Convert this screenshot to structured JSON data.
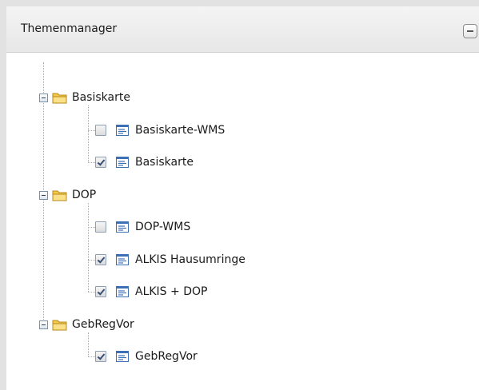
{
  "panel": {
    "title": "Themenmanager"
  },
  "tree": {
    "groups": [
      {
        "label": "Basiskarte",
        "expanded": true,
        "layers": [
          {
            "label": "Basiskarte-WMS",
            "checked": false
          },
          {
            "label": "Basiskarte",
            "checked": true
          }
        ]
      },
      {
        "label": "DOP",
        "expanded": true,
        "layers": [
          {
            "label": "DOP-WMS",
            "checked": false
          },
          {
            "label": "ALKIS Hausumringe",
            "checked": true
          },
          {
            "label": "ALKIS + DOP",
            "checked": true
          }
        ]
      },
      {
        "label": "GebRegVor",
        "expanded": true,
        "layers": [
          {
            "label": "GebRegVor",
            "checked": true
          }
        ]
      }
    ]
  },
  "colors": {
    "folder": "#f2c94c",
    "checkmark": "#3a4f74",
    "layer_icon": "#3b6fb6"
  },
  "icons": {
    "group": "folder-icon",
    "layer": "layer-list-icon",
    "collapse": "collapse-minus-icon"
  }
}
